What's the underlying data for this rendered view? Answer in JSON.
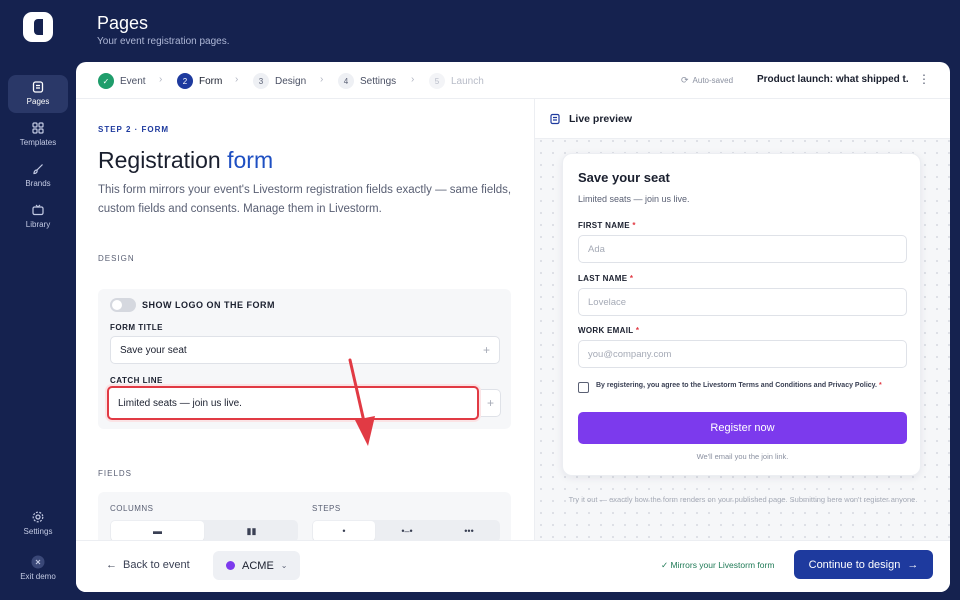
{
  "header": {
    "title": "Pages",
    "subtitle": "Your event registration pages."
  },
  "rail": {
    "items": [
      {
        "label": "Pages",
        "icon": "pages-icon"
      },
      {
        "label": "Templates",
        "icon": "templates-icon"
      },
      {
        "label": "Brands",
        "icon": "brush-icon"
      },
      {
        "label": "Library",
        "icon": "tv-icon"
      },
      {
        "label": "Settings",
        "icon": "gear-icon"
      },
      {
        "label": "Exit demo",
        "icon": "exit-icon"
      }
    ]
  },
  "stepper": {
    "steps": [
      {
        "num": "✓",
        "label": "Event",
        "state": "done"
      },
      {
        "num": "2",
        "label": "Form",
        "state": "active"
      },
      {
        "num": "3",
        "label": "Design",
        "state": "todo"
      },
      {
        "num": "4",
        "label": "Settings",
        "state": "todo"
      },
      {
        "num": "5",
        "label": "Launch",
        "state": "disabled"
      }
    ],
    "autosaved": "Auto-saved",
    "event_name": "Product launch: what shipped t..."
  },
  "form_panel": {
    "eyebrow": "STEP 2 · FORM",
    "heading_main": "Registration ",
    "heading_accent": "form",
    "description": "This form mirrors your event's Livestorm registration fields exactly — same fields, custom fields and consents. Manage them in Livestorm.",
    "design_label": "DESIGN",
    "show_logo_label": "SHOW LOGO ON THE FORM",
    "form_title_label": "FORM TITLE",
    "form_title_value": "Save your seat",
    "catch_line_label": "CATCH LINE",
    "catch_line_value": "Limited seats — join us live.",
    "fields_label": "FIELDS",
    "columns_label": "COLUMNS",
    "steps_label": "STEPS",
    "columns_options": [
      "▬",
      "▮▮"
    ],
    "steps_options": [
      "•",
      "•–•",
      "•••"
    ]
  },
  "preview": {
    "header": "Live preview",
    "title": "Save your seat",
    "catch_line": "Limited seats — join us live.",
    "fields": [
      {
        "label": "FIRST NAME",
        "placeholder": "Ada"
      },
      {
        "label": "LAST NAME",
        "placeholder": "Lovelace"
      },
      {
        "label": "WORK EMAIL",
        "placeholder": "you@company.com"
      }
    ],
    "required_mark": "*",
    "consent": "By registering, you agree to the Livestorm Terms and Conditions and Privacy Policy.",
    "register_button": "Register now",
    "email_note": "We'll email you the join link.",
    "try_note": "Try it out — exactly how the form renders on your published page. Submitting here won't register anyone."
  },
  "footer": {
    "back": "Back to event",
    "brand": "ACME",
    "mirrors": "Mirrors your Livestorm form",
    "continue": "Continue to design"
  },
  "colors": {
    "primary": "#1e3a9e",
    "accent_purple": "#7c3aed",
    "success": "#1f9d6b",
    "highlight": "#e13a44",
    "sidebar_bg": "#15224f"
  }
}
